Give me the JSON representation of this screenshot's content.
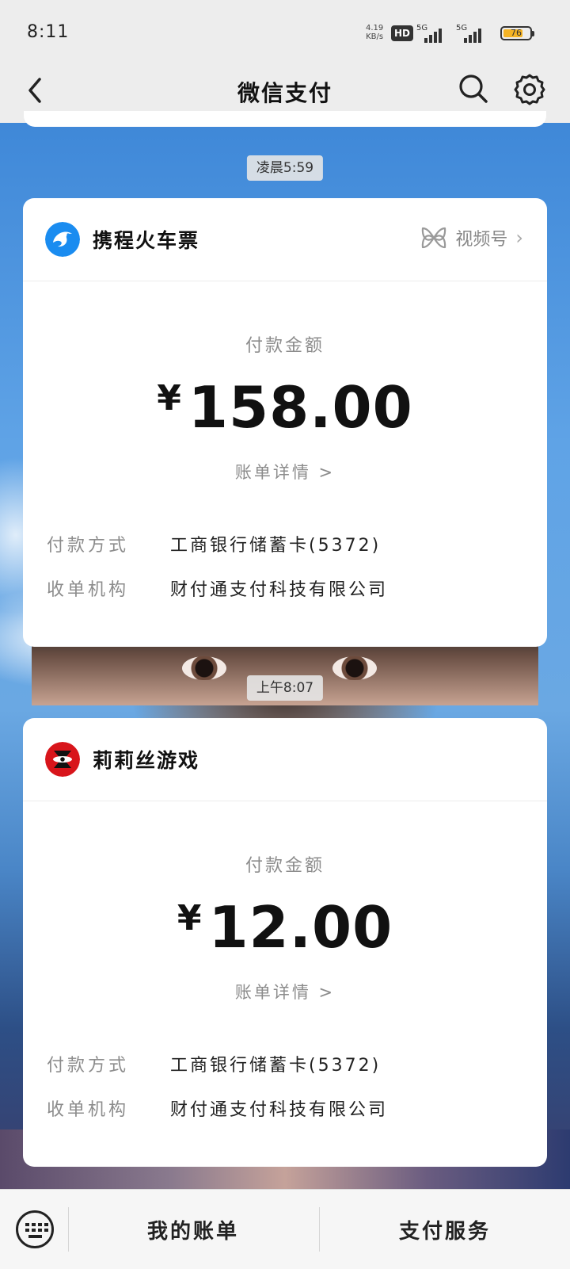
{
  "status_bar": {
    "time": "8:11",
    "net_speed": "4.19",
    "net_speed_unit": "KB/s",
    "hd_badge": "HD",
    "signal1_label": "5G",
    "signal2_label": "5G",
    "battery_level": "76",
    "battery_fraction": 0.76
  },
  "header": {
    "title": "微信支付",
    "back_icon": "chevron-left-icon",
    "search_icon": "search-icon",
    "settings_icon": "gear-icon"
  },
  "messages": [
    {
      "time_chip": "凌晨5:59",
      "merchant": "携程火车票",
      "channel_label": "视频号",
      "amount_label": "付款金额",
      "currency": "¥",
      "amount": "158.00",
      "detail_link": "账单详情 >",
      "payment_method_label": "付款方式",
      "payment_method": "工商银行储蓄卡(5372)",
      "acquirer_label": "收单机构",
      "acquirer": "财付通支付科技有限公司",
      "logo_color": "#1a8cf0"
    },
    {
      "time_chip": "上午8:07",
      "merchant": "莉莉丝游戏",
      "amount_label": "付款金额",
      "currency": "¥",
      "amount": "12.00",
      "detail_link": "账单详情 >",
      "payment_method_label": "付款方式",
      "payment_method": "工商银行储蓄卡(5372)",
      "acquirer_label": "收单机构",
      "acquirer": "财付通支付科技有限公司",
      "logo_color": "#d8151b"
    }
  ],
  "bottom_bar": {
    "keyboard_icon": "keyboard-icon",
    "my_bills": "我的账单",
    "pay_services": "支付服务"
  }
}
